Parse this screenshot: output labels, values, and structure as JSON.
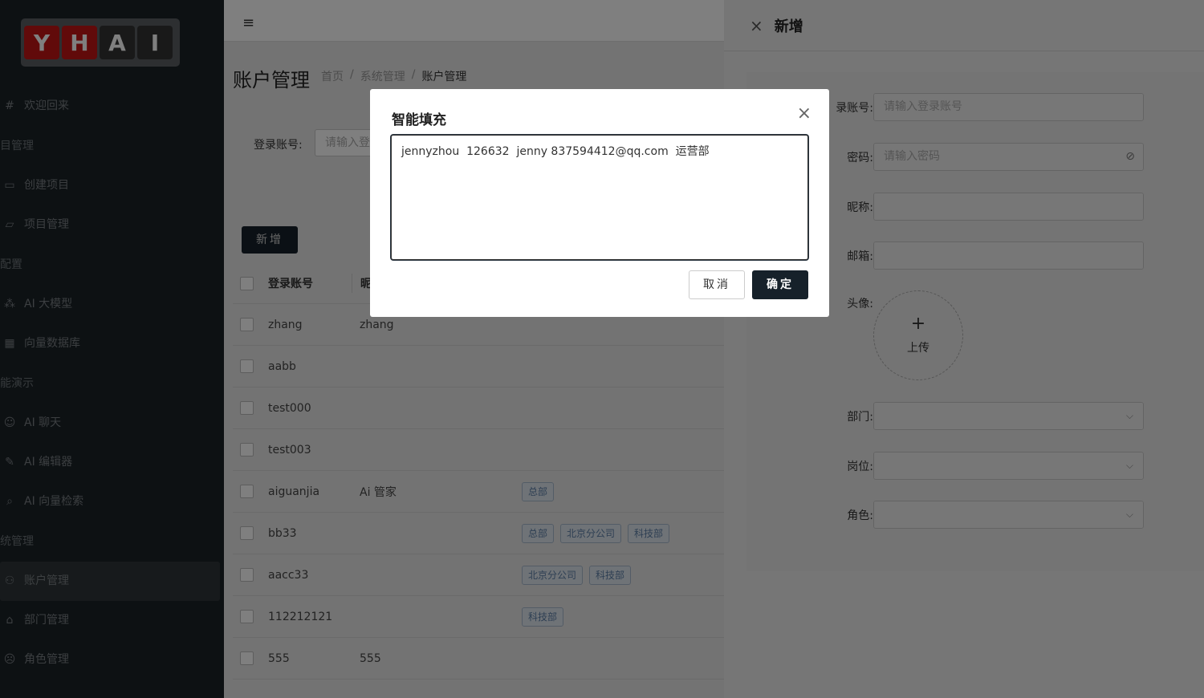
{
  "logo": {
    "letters": [
      "Y",
      "H",
      "A",
      "I"
    ]
  },
  "sidebar": {
    "items": [
      {
        "type": "item",
        "icon": "hash-icon",
        "glyph": "#",
        "label": "欢迎回来"
      },
      {
        "type": "group",
        "label": "目管理"
      },
      {
        "type": "item",
        "icon": "monitor-icon",
        "glyph": "▭",
        "label": "创建项目"
      },
      {
        "type": "item",
        "icon": "folder-icon",
        "glyph": "▱",
        "label": "项目管理"
      },
      {
        "type": "group",
        "label": "配置"
      },
      {
        "type": "item",
        "icon": "nodes-icon",
        "glyph": "⁂",
        "label": "AI 大模型"
      },
      {
        "type": "item",
        "icon": "grid-icon",
        "glyph": "▦",
        "label": "向量数据库"
      },
      {
        "type": "group",
        "label": "能演示"
      },
      {
        "type": "item",
        "icon": "robot-icon",
        "glyph": "☺",
        "label": "AI 聊天"
      },
      {
        "type": "item",
        "icon": "pen-icon",
        "glyph": "✎",
        "label": "AI 编辑器"
      },
      {
        "type": "item",
        "icon": "search-icon",
        "glyph": "⌕",
        "label": "AI 向量检索"
      },
      {
        "type": "group",
        "label": "统管理"
      },
      {
        "type": "item",
        "icon": "user-icon",
        "glyph": "⚇",
        "label": "账户管理",
        "active": true
      },
      {
        "type": "item",
        "icon": "bank-icon",
        "glyph": "⌂",
        "label": "部门管理"
      },
      {
        "type": "item",
        "icon": "face-icon",
        "glyph": "☹",
        "label": "角色管理"
      }
    ]
  },
  "main": {
    "menu_icon": "≡",
    "page_title": "账户管理",
    "breadcrumb": [
      "首页",
      "/",
      "系统管理",
      "/",
      "账户管理"
    ],
    "filter": {
      "label": "登录账号:",
      "placeholder": "请输入登"
    },
    "add_button": "新增",
    "table": {
      "headers": [
        "登录账号",
        "昵"
      ],
      "rows": [
        {
          "account": "zhang",
          "nick": "zhang",
          "tags": []
        },
        {
          "account": "aabb",
          "nick": "",
          "tags": []
        },
        {
          "account": "test000",
          "nick": "",
          "tags": []
        },
        {
          "account": "test003",
          "nick": "",
          "tags": []
        },
        {
          "account": "aiguanjia",
          "nick": "Ai 管家",
          "tags": [
            "总部"
          ]
        },
        {
          "account": "bb33",
          "nick": "",
          "tags": [
            "总部",
            "北京分公司",
            "科技部"
          ]
        },
        {
          "account": "aacc33",
          "nick": "",
          "tags": [
            "北京分公司",
            "科技部"
          ]
        },
        {
          "account": "112212121",
          "nick": "",
          "tags": [
            "科技部"
          ]
        },
        {
          "account": "555",
          "nick": "555",
          "tags": []
        }
      ]
    }
  },
  "drawer": {
    "title": "新增",
    "close_icon": "×",
    "fields": {
      "account": {
        "label": "录账号:",
        "placeholder": "请输入登录账号"
      },
      "password": {
        "label": "密码:",
        "placeholder": "请输入密码"
      },
      "nickname": {
        "label": "昵称:"
      },
      "email": {
        "label": "邮箱:"
      },
      "avatar": {
        "label": "头像:",
        "upload_plus": "+",
        "upload_text": "上传"
      },
      "department": {
        "label": "部门:"
      },
      "position": {
        "label": "岗位:"
      },
      "role": {
        "label": "角色:"
      }
    },
    "chevron": "⌵",
    "eye": "⊘"
  },
  "modal": {
    "title": "智能填充",
    "close_icon": "×",
    "text": "jennyzhou  126632  jenny 837594412@qq.com  运营部",
    "cancel": "取消",
    "ok": "确定"
  }
}
